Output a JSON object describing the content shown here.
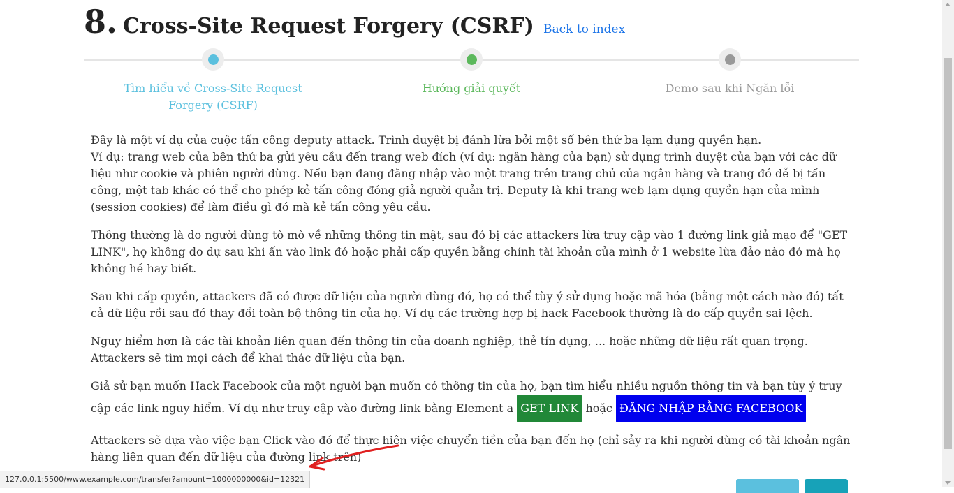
{
  "header": {
    "number": "8.",
    "title": "Cross-Site Request Forgery (CSRF)",
    "back_link": "Back to index"
  },
  "steps": [
    {
      "label": "Tìm hiểu về Cross-Site Request Forgery (CSRF)",
      "color": "#5bc0de"
    },
    {
      "label": "Hướng giải quyết",
      "color": "#5cb85c"
    },
    {
      "label": "Demo sau khi Ngăn lỗi",
      "color": "#999999"
    }
  ],
  "content": {
    "p1_line1": "Đây là một ví dụ của cuộc tấn công deputy attack. Trình duyệt bị đánh lừa bởi một số bên thứ ba lạm dụng quyền hạn.",
    "p1_line2": "Ví dụ: trang web của bên thứ ba gửi yêu cầu đến trang web đích (ví dụ: ngân hàng của bạn) sử dụng trình duyệt của bạn với các dữ liệu như cookie và phiên người dùng. Nếu bạn đang đăng nhập vào một trang trên trang chủ của ngân hàng và trang đó dễ bị tấn công, một tab khác có thể cho phép kẻ tấn công đóng giả người quản trị. Deputy là khi trang web lạm dụng quyền hạn của mình (session cookies) để làm điều gì đó mà kẻ tấn công yêu cầu.",
    "p2": "Thông thường là do người dùng tò mò về những thông tin mật, sau đó bị các attackers lừa truy cập vào 1 đường link giả mạo để \"GET LINK\", họ không do dự sau khi ấn vào link đó hoặc phải cấp quyền bằng chính tài khoản của mình ở 1 website lừa đảo nào đó mà họ không hề hay biết.",
    "p3": "Sau khi cấp quyền, attackers đã có được dữ liệu của người dùng đó, họ có thể tùy ý sử dụng hoặc mã hóa (bằng một cách nào đó) tất cả dữ liệu rồi sau đó thay đổi toàn bộ thông tin của họ. Ví dụ các trường hợp bị hack Facebook thường là do cấp quyền sai lệch.",
    "p4": "Nguy hiểm hơn là các tài khoản liên quan đến thông tin của doanh nghiệp, thẻ tín dụng, ... hoặc những dữ liệu rất quan trọng. Attackers sẽ tìm mọi cách để khai thác dữ liệu của bạn.",
    "p5_text": "Giả sử bạn muốn Hack Facebook của một người bạn muốn có thông tin của họ, bạn tìm hiểu nhiều nguồn thông tin và bạn tùy ý truy cập các link nguy hiểm. Ví dụ như truy cập vào đường link bằng Element a",
    "get_link_label": "GET LINK",
    "or_text": "hoặc",
    "fb_login_label": "ĐĂNG NHẬP BẰNG FACEBOOK",
    "p6": "Attackers sẽ dựa vào việc bạn Click vào đó để thực hiện việc chuyển tiền của bạn đến họ (chỉ sảy ra khi người dùng có tài khoản ngân hàng liên quan đến dữ liệu của đường link trên)"
  },
  "status_bar": {
    "url": "127.0.0.1:5500/www.example.com/transfer?amount=1000000000&id=12321"
  },
  "colors": {
    "get_link_bg": "#218838",
    "fb_login_bg": "#0000ee",
    "link": "#1a73e8",
    "arrow": "#e02020"
  }
}
